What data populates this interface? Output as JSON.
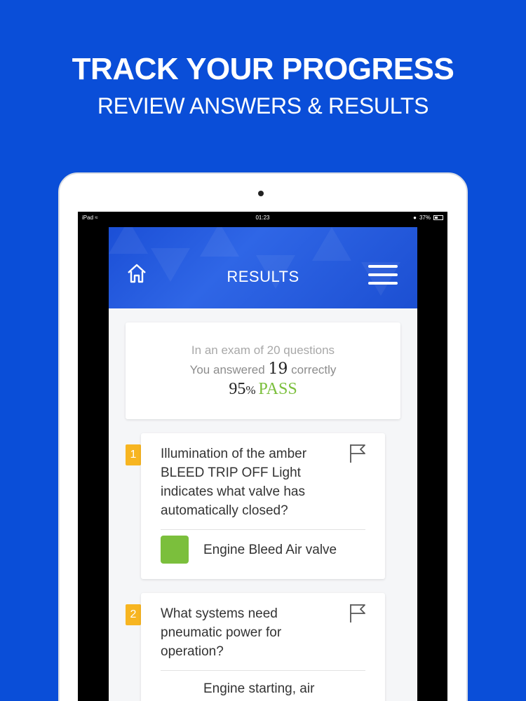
{
  "promo": {
    "title": "TRACK YOUR PROGRESS",
    "subtitle": "REVIEW ANSWERS & RESULTS"
  },
  "status_bar": {
    "device": "iPad",
    "time": "01:23",
    "battery": "37%",
    "battery_level": 0.37
  },
  "header": {
    "title": "RESULTS"
  },
  "summary": {
    "line1": "In an exam of 20 questions",
    "answered_prefix": "You answered",
    "correct_count": "19",
    "answered_suffix": "correctly",
    "percent_value": "95",
    "percent_sign": "%",
    "result": "PASS"
  },
  "questions": [
    {
      "number": "1",
      "text": "Illumination of the amber BLEED TRIP OFF Light indicates what valve has automatically closed?",
      "answer": "Engine Bleed Air valve"
    },
    {
      "number": "2",
      "text": "What systems need pneumatic power for operation?",
      "answer": "Engine starting, air"
    }
  ],
  "colors": {
    "background": "#0a4ed8",
    "badge": "#f7b521",
    "pass": "#7bbf3c"
  }
}
